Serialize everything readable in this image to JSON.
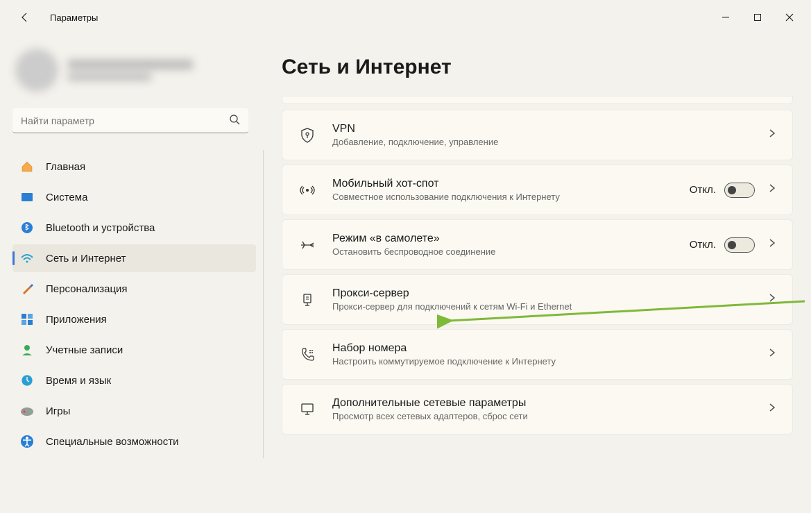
{
  "window": {
    "title": "Параметры"
  },
  "search": {
    "placeholder": "Найти параметр"
  },
  "nav": {
    "items": [
      {
        "label": "Главная"
      },
      {
        "label": "Система"
      },
      {
        "label": "Bluetooth и устройства"
      },
      {
        "label": "Сеть и Интернет"
      },
      {
        "label": "Персонализация"
      },
      {
        "label": "Приложения"
      },
      {
        "label": "Учетные записи"
      },
      {
        "label": "Время и язык"
      },
      {
        "label": "Игры"
      },
      {
        "label": "Специальные возможности"
      }
    ]
  },
  "page": {
    "title": "Сеть и Интернет"
  },
  "toggles": {
    "off": "Откл."
  },
  "cards": {
    "vpn": {
      "title": "VPN",
      "sub": "Добавление, подключение, управление"
    },
    "hotspot": {
      "title": "Мобильный хот-спот",
      "sub": "Совместное использование подключения к Интернету"
    },
    "airplane": {
      "title": "Режим «в самолете»",
      "sub": "Остановить беспроводное соединение"
    },
    "proxy": {
      "title": "Прокси-сервер",
      "sub": "Прокси-сервер для подключений к сетям Wi-Fi и Ethernet"
    },
    "dialup": {
      "title": "Набор номера",
      "sub": "Настроить коммутируемое подключение к Интернету"
    },
    "advanced": {
      "title": "Дополнительные сетевые параметры",
      "sub": "Просмотр всех сетевых адаптеров, сброс сети"
    }
  }
}
